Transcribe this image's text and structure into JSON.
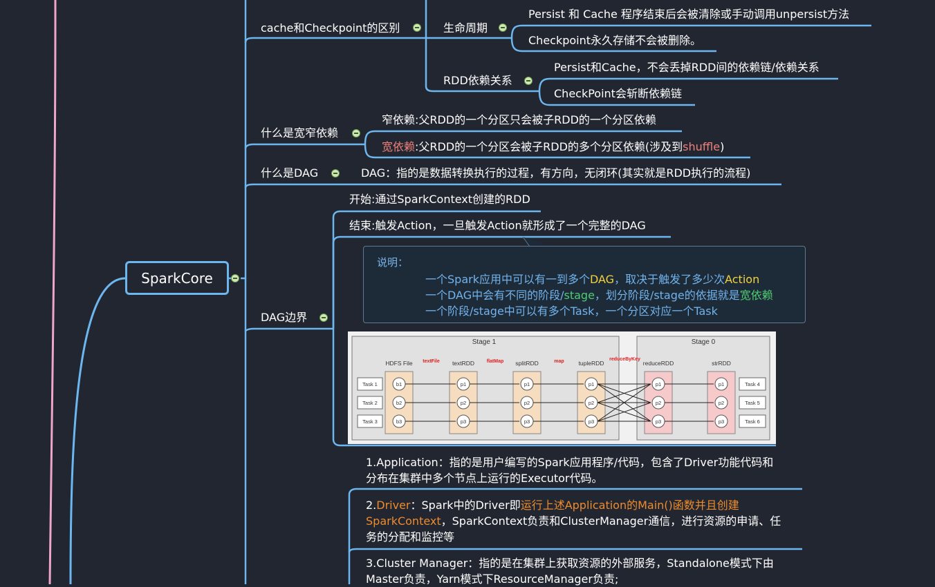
{
  "root": {
    "label": "SparkCore"
  },
  "colors": {
    "background": "#222630",
    "branch": "#6cb7ef",
    "left_pink_line": "#f0a6c8",
    "toggle_fill": "#cfe8b4",
    "highlight_red": "#f0807a",
    "highlight_yellow": "#f3d33c",
    "highlight_green": "#4fcd72",
    "highlight_orange": "#ef8b2c",
    "note_text_blue": "#72b3ec"
  },
  "branches": {
    "cache_vs_checkpoint": {
      "label": "cache和Checkpoint的区别",
      "lifecycle": {
        "label": "生命周期",
        "items": [
          "Persist 和 Cache  程序结束后会被清除或手动调用unpersist方法",
          "Checkpoint永久存储不会被删除。"
        ]
      },
      "rdd_dependency": {
        "label": "RDD依赖关系",
        "items": [
          "Persist和Cache，不会丢掉RDD间的依赖链/依赖关系",
          "CheckPoint会斩断依赖链"
        ]
      }
    },
    "wide_narrow": {
      "label": "什么是宽窄依赖",
      "narrow": "窄依赖:父RDD的一个分区只会被子RDD的一个分区依赖",
      "wide_prefix": "宽依赖",
      "wide_middle": ":父RDD的一个分区会被子RDD的多个分区依赖(涉及到",
      "wide_shuffle": "shuffle",
      "wide_suffix": ")"
    },
    "dag": {
      "label": "什么是DAG",
      "definition": "DAG：指的是数据转换执行的过程，有方向，无闭环(其实就是RDD执行的流程)"
    },
    "dag_boundary": {
      "label": "DAG边界",
      "start": "开始:通过SparkContext创建的RDD",
      "end": "结束:触发Action，一旦触发Action就形成了一个完整的DAG",
      "note": {
        "heading": "说明：",
        "line1_a": "一个Spark应用中可以有一到多个",
        "line1_b": "DAG",
        "line1_c": "，取决于触发了多少次",
        "line1_d": "Action",
        "line2_a": "一个DAG中会有不同的阶段/",
        "line2_b": "stage",
        "line2_c": "，划分阶段/stage的依据就是",
        "line2_d": "宽依赖",
        "line3_a": "一个阶段/stage中可以有多个Task，一个分区",
        "line3_b": "对应一个Task"
      },
      "diagram": {
        "stage1": "Stage 1",
        "stage0": "Stage 0",
        "rdds": [
          "HDFS File",
          "textRDD",
          "splitRDD",
          "tupleRDD",
          "reduceRDD",
          "strRDD"
        ],
        "ops": [
          "textFile",
          "flatMap",
          "map",
          "reduceByKey"
        ],
        "tasks_left": [
          "Task 1",
          "Task 2",
          "Task 3"
        ],
        "tasks_right": [
          "Task 4",
          "Task 5",
          "Task 6"
        ],
        "hdfs_parts": [
          "b1",
          "b2",
          "b3"
        ],
        "parts": [
          "p1",
          "p2",
          "p3"
        ]
      }
    },
    "concepts": {
      "application_l1": "1.Application：指的是用户编写的Spark应用程序/代码，包含了Driver功能代码和",
      "application_l2": "分布在集群中多个节点上运行的Executor代码。",
      "driver_num": "2.",
      "driver_word": "Driver",
      "driver_l1_mid": "：Spark中的Driver即",
      "driver_l1_org": "运行上述Application的Main()函数并且创建",
      "driver_l2_org": "SparkContext",
      "driver_l2_rest": "，SparkContext负责和ClusterManager通信，进行资源的申请、任",
      "driver_l3": "务的分配和监控等",
      "cm_l1": "3.Cluster Manager：指的是在集群上获取资源的外部服务，Standalone模式下由",
      "cm_l2": "Master负责，Yarn模式下ResourceManager负责;"
    }
  }
}
